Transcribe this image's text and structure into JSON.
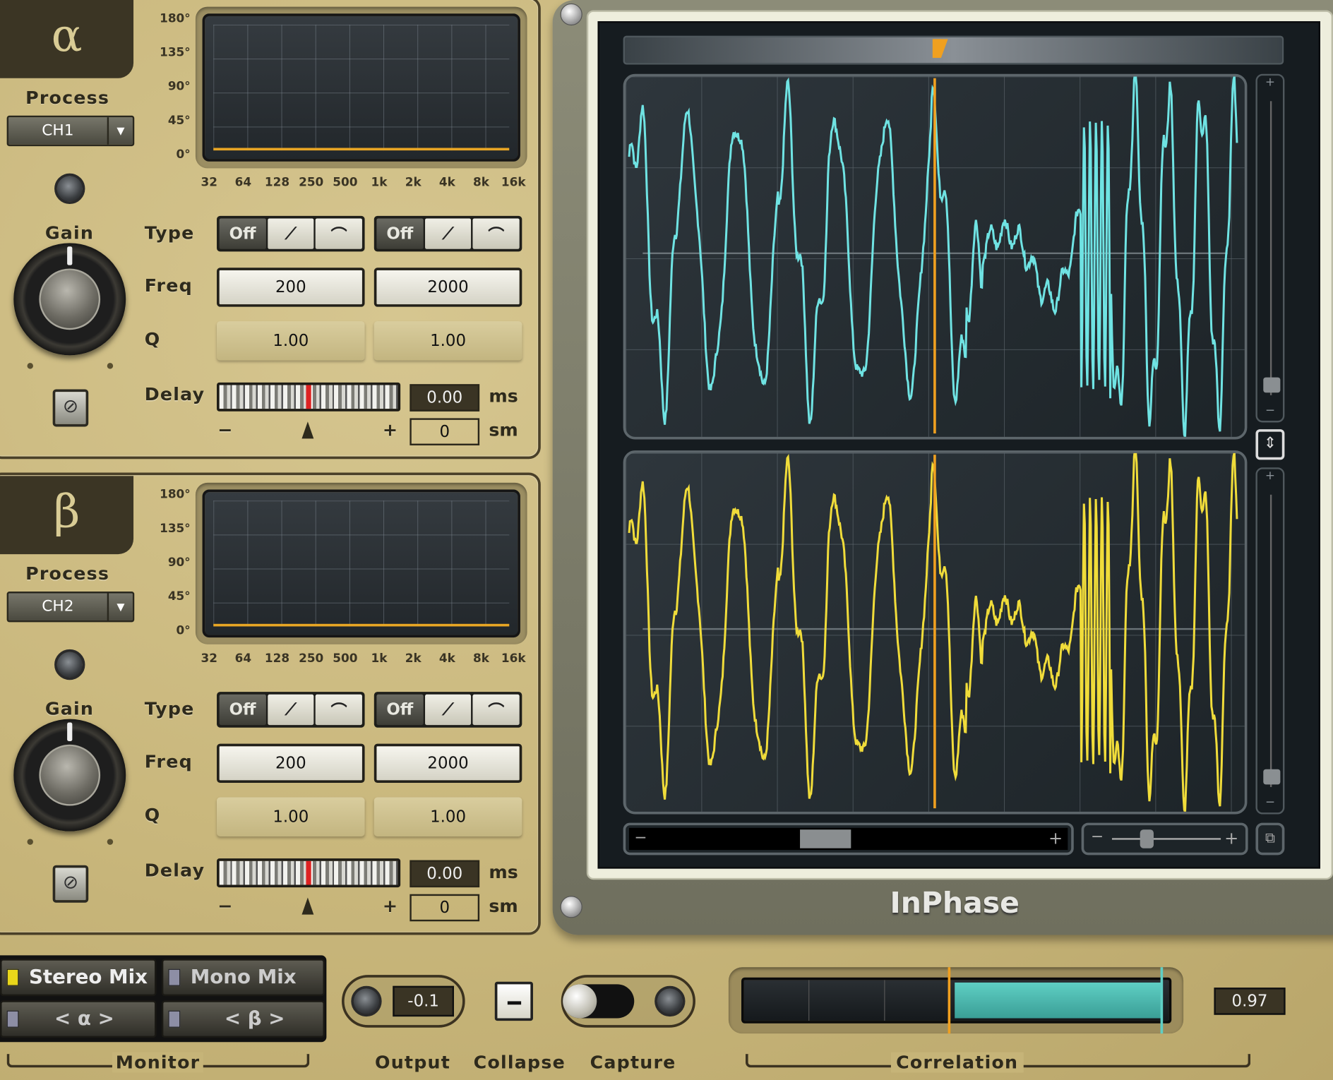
{
  "channels": [
    {
      "symbol": "α",
      "process_label": "Process",
      "process_value": "CH1",
      "gain_label": "Gain",
      "phase_axis": [
        "180°",
        "135°",
        "90°",
        "45°",
        "0°"
      ],
      "freq_axis": [
        "32",
        "64",
        "128",
        "250",
        "500",
        "1k",
        "2k",
        "4k",
        "8k",
        "16k"
      ],
      "type_label": "Type",
      "freq_label": "Freq",
      "q_label": "Q",
      "delay_label": "Delay",
      "filter1": {
        "off": "Off",
        "freq": "200",
        "q": "1.00"
      },
      "filter2": {
        "off": "Off",
        "freq": "2000",
        "q": "1.00"
      },
      "delay_ms": "0.00",
      "delay_ms_unit": "ms",
      "delay_samples": "0",
      "delay_samples_unit": "sm",
      "minus": "−",
      "plus": "+"
    },
    {
      "symbol": "β",
      "process_label": "Process",
      "process_value": "CH2",
      "gain_label": "Gain",
      "phase_axis": [
        "180°",
        "135°",
        "90°",
        "45°",
        "0°"
      ],
      "freq_axis": [
        "32",
        "64",
        "128",
        "250",
        "500",
        "1k",
        "2k",
        "4k",
        "8k",
        "16k"
      ],
      "type_label": "Type",
      "freq_label": "Freq",
      "q_label": "Q",
      "delay_label": "Delay",
      "filter1": {
        "off": "Off",
        "freq": "200",
        "q": "1.00"
      },
      "filter2": {
        "off": "Off",
        "freq": "2000",
        "q": "1.00"
      },
      "delay_ms": "0.00",
      "delay_ms_unit": "ms",
      "delay_samples": "0",
      "delay_samples_unit": "sm",
      "minus": "−",
      "plus": "+"
    }
  ],
  "scope": {
    "brand": "InPhase",
    "upper_color": "#6fe3e3",
    "lower_color": "#f0dc3a",
    "cursor_color": "#f0a020",
    "minus": "−",
    "plus": "+"
  },
  "bottom": {
    "monitor": {
      "stereo_mix": "Stereo Mix",
      "mono_mix": "Mono Mix",
      "alpha": "< α >",
      "beta": "< β >",
      "label": "Monitor",
      "active": "Stereo Mix"
    },
    "output": {
      "value": "-0.1",
      "label": "Output"
    },
    "collapse": {
      "label": "Collapse"
    },
    "capture": {
      "label": "Capture"
    },
    "correlation": {
      "label": "Correlation",
      "value": "0.97"
    }
  }
}
